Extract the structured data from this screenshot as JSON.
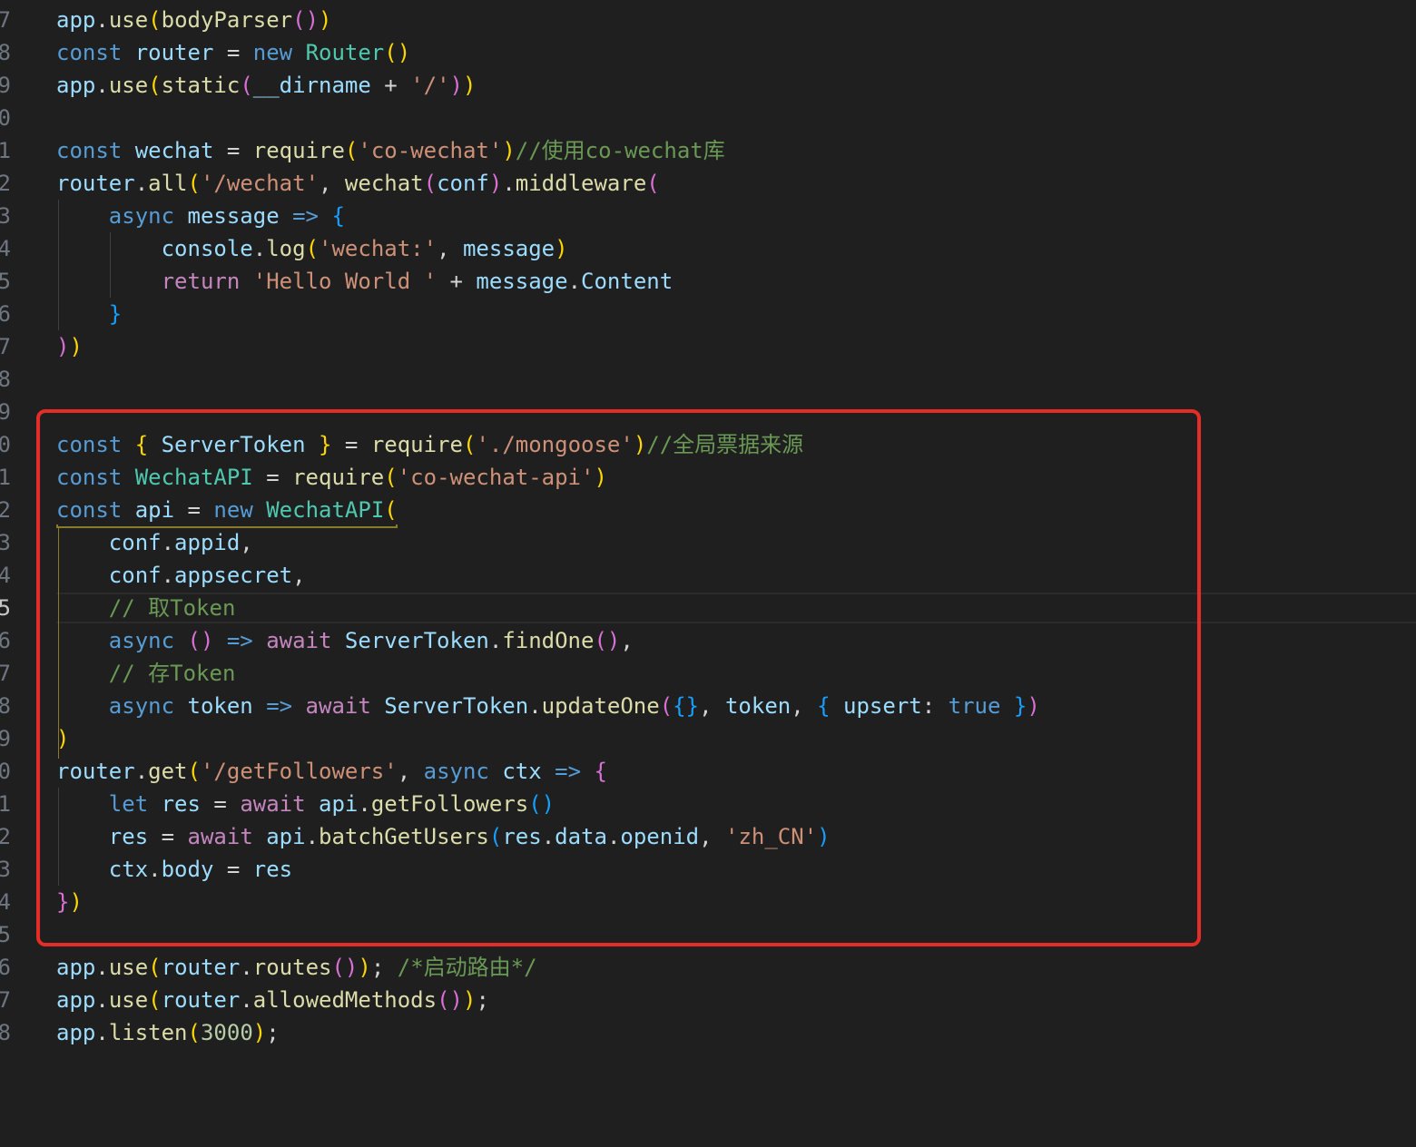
{
  "editor": {
    "colors": {
      "background": "#1f1f1f",
      "highlight_box": "#e52d27",
      "keyword": "#569cd6",
      "control": "#c586c0",
      "variable": "#9cdcfe",
      "function": "#dcdcaa",
      "class": "#4ec9b0",
      "string": "#ce9178",
      "comment": "#6a9955"
    },
    "lines": [
      {
        "number": "7",
        "tokens": [
          {
            "t": "app",
            "c": "variable"
          },
          {
            "t": ".",
            "c": "plain"
          },
          {
            "t": "use",
            "c": "function"
          },
          {
            "t": "(",
            "c": "brace-1"
          },
          {
            "t": "bodyParser",
            "c": "function"
          },
          {
            "t": "()",
            "c": "brace-2"
          },
          {
            "t": ")",
            "c": "brace-1"
          }
        ]
      },
      {
        "number": "8",
        "tokens": [
          {
            "t": "const ",
            "c": "keyword"
          },
          {
            "t": "router",
            "c": "variable"
          },
          {
            "t": " = ",
            "c": "plain"
          },
          {
            "t": "new ",
            "c": "keyword"
          },
          {
            "t": "Router",
            "c": "class"
          },
          {
            "t": "()",
            "c": "brace-1"
          }
        ]
      },
      {
        "number": "9",
        "tokens": [
          {
            "t": "app",
            "c": "variable"
          },
          {
            "t": ".",
            "c": "plain"
          },
          {
            "t": "use",
            "c": "function"
          },
          {
            "t": "(",
            "c": "brace-1"
          },
          {
            "t": "static",
            "c": "function"
          },
          {
            "t": "(",
            "c": "brace-2"
          },
          {
            "t": "__dirname",
            "c": "variable"
          },
          {
            "t": " + ",
            "c": "plain"
          },
          {
            "t": "'/'",
            "c": "string"
          },
          {
            "t": ")",
            "c": "brace-2"
          },
          {
            "t": ")",
            "c": "brace-1"
          }
        ]
      },
      {
        "number": "0",
        "tokens": []
      },
      {
        "number": "1",
        "tokens": [
          {
            "t": "const ",
            "c": "keyword"
          },
          {
            "t": "wechat",
            "c": "variable"
          },
          {
            "t": " = ",
            "c": "plain"
          },
          {
            "t": "require",
            "c": "function"
          },
          {
            "t": "(",
            "c": "brace-1"
          },
          {
            "t": "'co-wechat'",
            "c": "string"
          },
          {
            "t": ")",
            "c": "brace-1"
          },
          {
            "t": "//使用co-wechat库",
            "c": "comment"
          }
        ]
      },
      {
        "number": "2",
        "tokens": [
          {
            "t": "router",
            "c": "variable"
          },
          {
            "t": ".",
            "c": "plain"
          },
          {
            "t": "all",
            "c": "function"
          },
          {
            "t": "(",
            "c": "brace-1"
          },
          {
            "t": "'/wechat'",
            "c": "string"
          },
          {
            "t": ", ",
            "c": "plain"
          },
          {
            "t": "wechat",
            "c": "function"
          },
          {
            "t": "(",
            "c": "brace-2"
          },
          {
            "t": "conf",
            "c": "variable"
          },
          {
            "t": ")",
            "c": "brace-2"
          },
          {
            "t": ".",
            "c": "plain"
          },
          {
            "t": "middleware",
            "c": "function"
          },
          {
            "t": "(",
            "c": "brace-2"
          }
        ]
      },
      {
        "number": "3",
        "tokens": [
          {
            "t": "    ",
            "c": "plain"
          },
          {
            "t": "async ",
            "c": "keyword"
          },
          {
            "t": "message",
            "c": "variable"
          },
          {
            "t": " => ",
            "c": "keyword"
          },
          {
            "t": "{",
            "c": "brace-3"
          }
        ]
      },
      {
        "number": "4",
        "tokens": [
          {
            "t": "        ",
            "c": "plain"
          },
          {
            "t": "console",
            "c": "variable"
          },
          {
            "t": ".",
            "c": "plain"
          },
          {
            "t": "log",
            "c": "function"
          },
          {
            "t": "(",
            "c": "brace-1"
          },
          {
            "t": "'wechat:'",
            "c": "string"
          },
          {
            "t": ", ",
            "c": "plain"
          },
          {
            "t": "message",
            "c": "variable"
          },
          {
            "t": ")",
            "c": "brace-1"
          }
        ]
      },
      {
        "number": "5",
        "tokens": [
          {
            "t": "        ",
            "c": "plain"
          },
          {
            "t": "return ",
            "c": "control"
          },
          {
            "t": "'Hello World '",
            "c": "string"
          },
          {
            "t": " + ",
            "c": "plain"
          },
          {
            "t": "message",
            "c": "variable"
          },
          {
            "t": ".",
            "c": "plain"
          },
          {
            "t": "Content",
            "c": "variable"
          }
        ]
      },
      {
        "number": "6",
        "tokens": [
          {
            "t": "    ",
            "c": "plain"
          },
          {
            "t": "}",
            "c": "brace-3"
          }
        ]
      },
      {
        "number": "7",
        "tokens": [
          {
            "t": ")",
            "c": "brace-2"
          },
          {
            "t": ")",
            "c": "brace-1"
          }
        ]
      },
      {
        "number": "8",
        "tokens": []
      },
      {
        "number": "9",
        "tokens": []
      },
      {
        "number": "0",
        "tokens": [
          {
            "t": "const ",
            "c": "keyword"
          },
          {
            "t": "{ ",
            "c": "brace-1"
          },
          {
            "t": "ServerToken",
            "c": "variable"
          },
          {
            "t": " }",
            "c": "brace-1"
          },
          {
            "t": " = ",
            "c": "plain"
          },
          {
            "t": "require",
            "c": "function"
          },
          {
            "t": "(",
            "c": "brace-1"
          },
          {
            "t": "'./mongoose'",
            "c": "string"
          },
          {
            "t": ")",
            "c": "brace-1"
          },
          {
            "t": "//全局票据来源",
            "c": "comment"
          }
        ]
      },
      {
        "number": "1",
        "tokens": [
          {
            "t": "const ",
            "c": "keyword"
          },
          {
            "t": "WechatAPI",
            "c": "class"
          },
          {
            "t": " = ",
            "c": "plain"
          },
          {
            "t": "require",
            "c": "function"
          },
          {
            "t": "(",
            "c": "brace-1"
          },
          {
            "t": "'co-wechat-api'",
            "c": "string"
          },
          {
            "t": ")",
            "c": "brace-1"
          }
        ]
      },
      {
        "number": "2",
        "tokens": [
          {
            "t": "const ",
            "c": "keyword"
          },
          {
            "t": "api",
            "c": "variable"
          },
          {
            "t": " = ",
            "c": "plain"
          },
          {
            "t": "new ",
            "c": "keyword"
          },
          {
            "t": "WechatAPI",
            "c": "class"
          },
          {
            "t": "(",
            "c": "brace-1"
          }
        ]
      },
      {
        "number": "3",
        "tokens": [
          {
            "t": "    ",
            "c": "plain"
          },
          {
            "t": "conf",
            "c": "variable"
          },
          {
            "t": ".",
            "c": "plain"
          },
          {
            "t": "appid",
            "c": "variable"
          },
          {
            "t": ",",
            "c": "plain"
          }
        ]
      },
      {
        "number": "4",
        "tokens": [
          {
            "t": "    ",
            "c": "plain"
          },
          {
            "t": "conf",
            "c": "variable"
          },
          {
            "t": ".",
            "c": "plain"
          },
          {
            "t": "appsecret",
            "c": "variable"
          },
          {
            "t": ",",
            "c": "plain"
          }
        ]
      },
      {
        "number": "5",
        "current": true,
        "tokens": [
          {
            "t": "    ",
            "c": "plain"
          },
          {
            "t": "// 取Token",
            "c": "comment"
          }
        ]
      },
      {
        "number": "6",
        "tokens": [
          {
            "t": "    ",
            "c": "plain"
          },
          {
            "t": "async ",
            "c": "keyword"
          },
          {
            "t": "()",
            "c": "brace-2"
          },
          {
            "t": " => ",
            "c": "keyword"
          },
          {
            "t": "await ",
            "c": "control"
          },
          {
            "t": "ServerToken",
            "c": "variable"
          },
          {
            "t": ".",
            "c": "plain"
          },
          {
            "t": "findOne",
            "c": "function"
          },
          {
            "t": "()",
            "c": "brace-2"
          },
          {
            "t": ",",
            "c": "plain"
          }
        ]
      },
      {
        "number": "7",
        "tokens": [
          {
            "t": "    ",
            "c": "plain"
          },
          {
            "t": "// 存Token",
            "c": "comment"
          }
        ]
      },
      {
        "number": "8",
        "tokens": [
          {
            "t": "    ",
            "c": "plain"
          },
          {
            "t": "async ",
            "c": "keyword"
          },
          {
            "t": "token",
            "c": "variable"
          },
          {
            "t": " => ",
            "c": "keyword"
          },
          {
            "t": "await ",
            "c": "control"
          },
          {
            "t": "ServerToken",
            "c": "variable"
          },
          {
            "t": ".",
            "c": "plain"
          },
          {
            "t": "updateOne",
            "c": "function"
          },
          {
            "t": "(",
            "c": "brace-2"
          },
          {
            "t": "{}",
            "c": "brace-3"
          },
          {
            "t": ", ",
            "c": "plain"
          },
          {
            "t": "token",
            "c": "variable"
          },
          {
            "t": ", ",
            "c": "plain"
          },
          {
            "t": "{ ",
            "c": "brace-3"
          },
          {
            "t": "upsert",
            "c": "variable"
          },
          {
            "t": ": ",
            "c": "plain"
          },
          {
            "t": "true",
            "c": "keyword"
          },
          {
            "t": " }",
            "c": "brace-3"
          },
          {
            "t": ")",
            "c": "brace-2"
          }
        ]
      },
      {
        "number": "9",
        "tokens": [
          {
            "t": ")",
            "c": "brace-1"
          }
        ]
      },
      {
        "number": "0",
        "tokens": [
          {
            "t": "router",
            "c": "variable"
          },
          {
            "t": ".",
            "c": "plain"
          },
          {
            "t": "get",
            "c": "function"
          },
          {
            "t": "(",
            "c": "brace-1"
          },
          {
            "t": "'/getFollowers'",
            "c": "string"
          },
          {
            "t": ", ",
            "c": "plain"
          },
          {
            "t": "async ",
            "c": "keyword"
          },
          {
            "t": "ctx",
            "c": "variable"
          },
          {
            "t": " => ",
            "c": "keyword"
          },
          {
            "t": "{",
            "c": "brace-2"
          }
        ]
      },
      {
        "number": "1",
        "tokens": [
          {
            "t": "    ",
            "c": "plain"
          },
          {
            "t": "let ",
            "c": "keyword"
          },
          {
            "t": "res",
            "c": "variable"
          },
          {
            "t": " = ",
            "c": "plain"
          },
          {
            "t": "await ",
            "c": "control"
          },
          {
            "t": "api",
            "c": "variable"
          },
          {
            "t": ".",
            "c": "plain"
          },
          {
            "t": "getFollowers",
            "c": "function"
          },
          {
            "t": "()",
            "c": "brace-3"
          }
        ]
      },
      {
        "number": "2",
        "tokens": [
          {
            "t": "    ",
            "c": "plain"
          },
          {
            "t": "res",
            "c": "variable"
          },
          {
            "t": " = ",
            "c": "plain"
          },
          {
            "t": "await ",
            "c": "control"
          },
          {
            "t": "api",
            "c": "variable"
          },
          {
            "t": ".",
            "c": "plain"
          },
          {
            "t": "batchGetUsers",
            "c": "function"
          },
          {
            "t": "(",
            "c": "brace-3"
          },
          {
            "t": "res",
            "c": "variable"
          },
          {
            "t": ".",
            "c": "plain"
          },
          {
            "t": "data",
            "c": "variable"
          },
          {
            "t": ".",
            "c": "plain"
          },
          {
            "t": "openid",
            "c": "variable"
          },
          {
            "t": ", ",
            "c": "plain"
          },
          {
            "t": "'zh_CN'",
            "c": "string"
          },
          {
            "t": ")",
            "c": "brace-3"
          }
        ]
      },
      {
        "number": "3",
        "tokens": [
          {
            "t": "    ",
            "c": "plain"
          },
          {
            "t": "ctx",
            "c": "variable"
          },
          {
            "t": ".",
            "c": "plain"
          },
          {
            "t": "body",
            "c": "variable"
          },
          {
            "t": " = ",
            "c": "plain"
          },
          {
            "t": "res",
            "c": "variable"
          }
        ]
      },
      {
        "number": "4",
        "tokens": [
          {
            "t": "}",
            "c": "brace-2"
          },
          {
            "t": ")",
            "c": "brace-1"
          }
        ]
      },
      {
        "number": "5",
        "tokens": []
      },
      {
        "number": "6",
        "tokens": [
          {
            "t": "app",
            "c": "variable"
          },
          {
            "t": ".",
            "c": "plain"
          },
          {
            "t": "use",
            "c": "function"
          },
          {
            "t": "(",
            "c": "brace-1"
          },
          {
            "t": "router",
            "c": "variable"
          },
          {
            "t": ".",
            "c": "plain"
          },
          {
            "t": "routes",
            "c": "function"
          },
          {
            "t": "()",
            "c": "brace-2"
          },
          {
            "t": ")",
            "c": "brace-1"
          },
          {
            "t": "; ",
            "c": "plain"
          },
          {
            "t": "/*启动路由*/",
            "c": "comment"
          }
        ]
      },
      {
        "number": "7",
        "tokens": [
          {
            "t": "app",
            "c": "variable"
          },
          {
            "t": ".",
            "c": "plain"
          },
          {
            "t": "use",
            "c": "function"
          },
          {
            "t": "(",
            "c": "brace-1"
          },
          {
            "t": "router",
            "c": "variable"
          },
          {
            "t": ".",
            "c": "plain"
          },
          {
            "t": "allowedMethods",
            "c": "function"
          },
          {
            "t": "()",
            "c": "brace-2"
          },
          {
            "t": ")",
            "c": "brace-1"
          },
          {
            "t": ";",
            "c": "plain"
          }
        ]
      },
      {
        "number": "8",
        "tokens": [
          {
            "t": "app",
            "c": "variable"
          },
          {
            "t": ".",
            "c": "plain"
          },
          {
            "t": "listen",
            "c": "function"
          },
          {
            "t": "(",
            "c": "brace-1"
          },
          {
            "t": "3000",
            "c": "number"
          },
          {
            "t": ")",
            "c": "brace-1"
          },
          {
            "t": ";",
            "c": "plain"
          }
        ]
      }
    ]
  }
}
